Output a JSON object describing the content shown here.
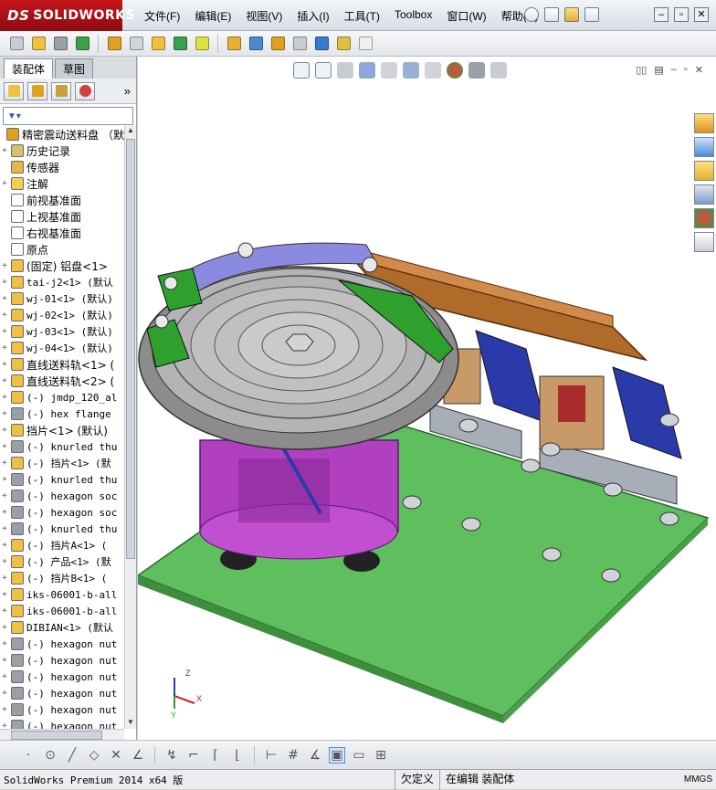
{
  "app": {
    "logo": "SOLIDWORKS",
    "logo_prefix": "DS"
  },
  "menu": [
    {
      "label": "文件(F)"
    },
    {
      "label": "编辑(E)"
    },
    {
      "label": "视图(V)"
    },
    {
      "label": "插入(I)"
    },
    {
      "label": "工具(T)"
    },
    {
      "label": "Toolbox"
    },
    {
      "label": "窗口(W)"
    },
    {
      "label": "帮助(H)"
    }
  ],
  "panel": {
    "tabs": [
      {
        "label": "装配体"
      },
      {
        "label": "草图"
      }
    ],
    "more": "»"
  },
  "tree": [
    {
      "exp": "",
      "label": "精密震动送料盘 （默",
      "cn": true,
      "icon": "#e0a020"
    },
    {
      "exp": "+",
      "label": "历史记录",
      "cn": true,
      "icon": "#d8c070"
    },
    {
      "exp": "",
      "label": "传感器",
      "cn": true,
      "icon": "#e6b84a"
    },
    {
      "exp": "+",
      "label": "注解",
      "cn": true,
      "icon": "#f0d050"
    },
    {
      "exp": "",
      "label": "前视基准面",
      "cn": true,
      "icon": "#ffffff"
    },
    {
      "exp": "",
      "label": "上视基准面",
      "cn": true,
      "icon": "#ffffff"
    },
    {
      "exp": "",
      "label": "右视基准面",
      "cn": true,
      "icon": "#ffffff"
    },
    {
      "exp": "",
      "label": "原点",
      "cn": true,
      "icon": "#ffffff"
    },
    {
      "exp": "+",
      "label": "(固定) 铝盘<1> ",
      "cn": true,
      "icon": "#f0c040"
    },
    {
      "exp": "+",
      "label": "tai-j2<1> (默认",
      "cn": false,
      "icon": "#f0c040"
    },
    {
      "exp": "+",
      "label": "wj-01<1> (默认)",
      "cn": false,
      "icon": "#f0c040"
    },
    {
      "exp": "+",
      "label": "wj-02<1> (默认)",
      "cn": false,
      "icon": "#f0c040"
    },
    {
      "exp": "+",
      "label": "wj-03<1> (默认)",
      "cn": false,
      "icon": "#f0c040"
    },
    {
      "exp": "+",
      "label": "wj-04<1> (默认)",
      "cn": false,
      "icon": "#f0c040"
    },
    {
      "exp": "+",
      "label": "直线送料轨<1> (",
      "cn": true,
      "icon": "#f0c040"
    },
    {
      "exp": "+",
      "label": "直线送料轨<2> (",
      "cn": true,
      "icon": "#f0c040"
    },
    {
      "exp": "+",
      "label": "(-) jmdp_120_al",
      "cn": false,
      "icon": "#f0c040"
    },
    {
      "exp": "+",
      "label": "(-) hex flange ",
      "cn": false,
      "icon": "#9aa0a8"
    },
    {
      "exp": "+",
      "label": "挡片<1> (默认)",
      "cn": true,
      "icon": "#f0c040"
    },
    {
      "exp": "+",
      "label": "(-) knurled thu",
      "cn": false,
      "icon": "#9aa0a8"
    },
    {
      "exp": "+",
      "label": "(-) 挡片<1> (默",
      "cn": false,
      "icon": "#f0c040"
    },
    {
      "exp": "+",
      "label": "(-) knurled thu",
      "cn": false,
      "icon": "#9aa0a8"
    },
    {
      "exp": "+",
      "label": "(-) hexagon soc",
      "cn": false,
      "icon": "#9aa0a8"
    },
    {
      "exp": "+",
      "label": "(-) hexagon soc",
      "cn": false,
      "icon": "#9aa0a8"
    },
    {
      "exp": "+",
      "label": "(-) knurled thu",
      "cn": false,
      "icon": "#9aa0a8"
    },
    {
      "exp": "+",
      "label": "(-) 挡片A<1> (",
      "cn": false,
      "icon": "#f0c040"
    },
    {
      "exp": "+",
      "label": "(-) 产品<1> (默",
      "cn": false,
      "icon": "#f0c040"
    },
    {
      "exp": "+",
      "label": "(-) 挡片B<1> (",
      "cn": false,
      "icon": "#f0c040"
    },
    {
      "exp": "+",
      "label": "iks-06001-b-all",
      "cn": false,
      "icon": "#f0c040"
    },
    {
      "exp": "+",
      "label": "iks-06001-b-all",
      "cn": false,
      "icon": "#f0c040"
    },
    {
      "exp": "+",
      "label": "DIBIAN<1> (默认",
      "cn": false,
      "icon": "#f0c040"
    },
    {
      "exp": "+",
      "label": "(-) hexagon nut",
      "cn": false,
      "icon": "#9aa0a8"
    },
    {
      "exp": "+",
      "label": "(-) hexagon nut",
      "cn": false,
      "icon": "#9aa0a8"
    },
    {
      "exp": "+",
      "label": "(-) hexagon nut",
      "cn": false,
      "icon": "#9aa0a8"
    },
    {
      "exp": "+",
      "label": "(-) hexagon nut",
      "cn": false,
      "icon": "#9aa0a8"
    },
    {
      "exp": "+",
      "label": "(-) hexagon nut",
      "cn": false,
      "icon": "#9aa0a8"
    },
    {
      "exp": "+",
      "label": "(-) hexagon nut",
      "cn": false,
      "icon": "#9aa0a8"
    }
  ],
  "status": {
    "product": "SolidWorks Premium 2014 x64 版",
    "constraint": "欠定义",
    "mode": "在编辑 装配体",
    "units": "MMGS"
  },
  "triad": {
    "x": "X",
    "y": "Y",
    "z": "Z"
  },
  "colors": {
    "plate": "#5fbf5f",
    "bowl": "#9a9a9a",
    "base": "#b040c0",
    "rail": "#b06a2a",
    "bracket": "#2a3aa8",
    "accent": "#2ea02e"
  }
}
